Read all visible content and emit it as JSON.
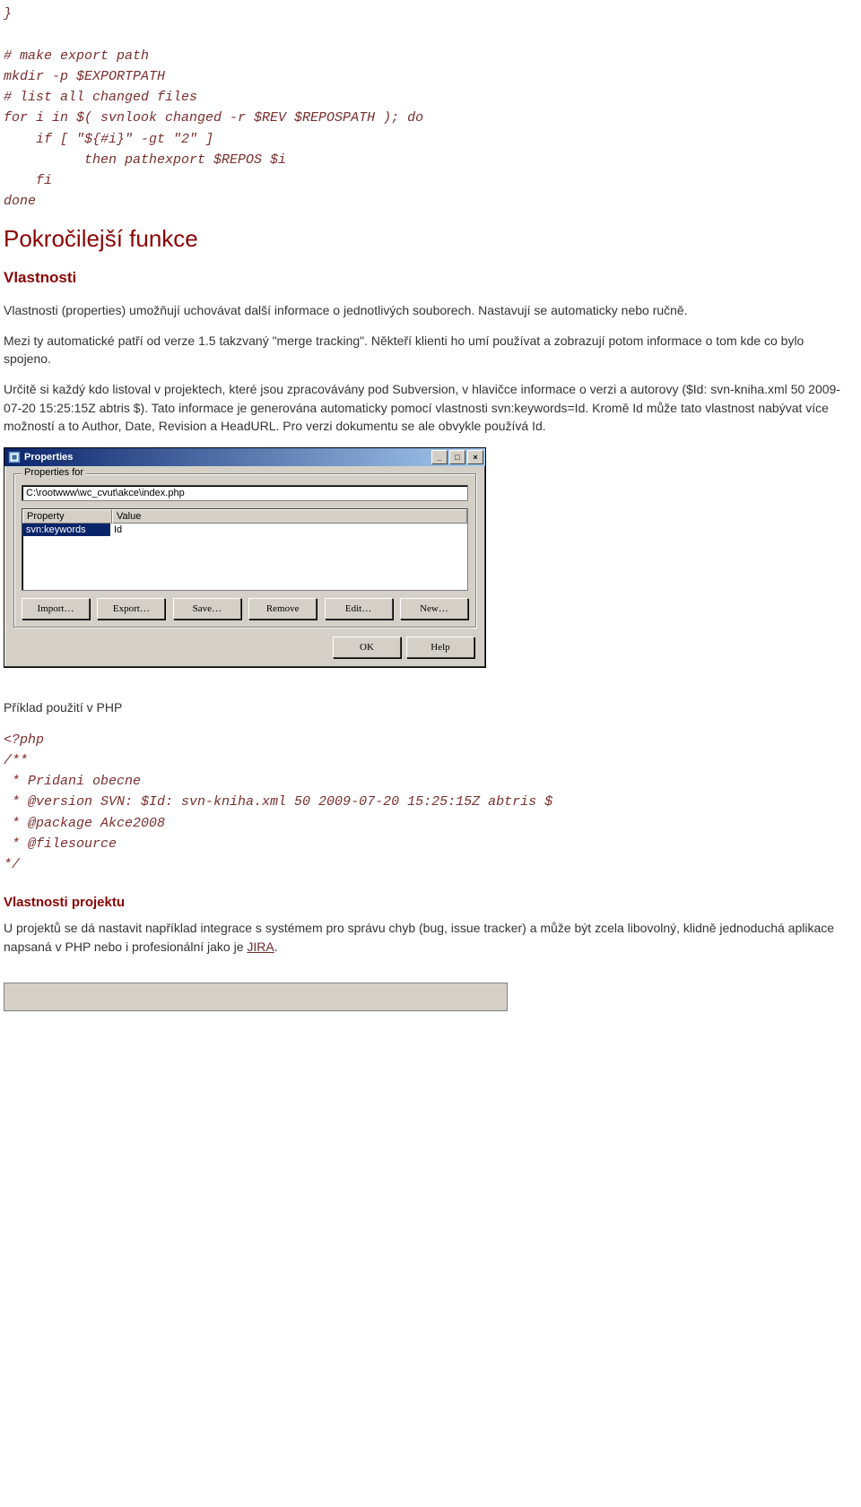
{
  "code1": "}\n\n# make export path\nmkdir -p $EXPORTPATH\n# list all changed files\nfor i in $( svnlook changed -r $REV $REPOSPATH ); do\n    if [ \"${#i}\" -gt \"2\" ]\n          then pathexport $REPOS $i\n    fi\ndone",
  "h1": "Pokročilejší funkce",
  "sec1": {
    "title": "Vlastnosti",
    "p1": "Vlastnosti (properties) umožňují uchovávat další informace o jednotlivých souborech. Nastavují se automaticky nebo ručně.",
    "p2": "Mezi ty automatické patří od verze 1.5 takzvaný \"merge tracking\". Někteří klienti ho umí používat a zobrazují potom informace o tom kde co bylo spojeno.",
    "p3": "Určitě si každý kdo listoval v projektech, které jsou zpracovávány pod Subversion, v hlavičce informace o verzi a autorovy ($Id: svn-kniha.xml 50 2009-07-20 15:25:15Z abtris $). Tato informace je generována automaticky pomocí vlastnosti svn:keywords=Id. Kromě Id může tato vlastnost nabývat více možností a to Author, Date, Revision a HeadURL. Pro verzi dokumentu se ale obvykle používá Id."
  },
  "dialog": {
    "title": "Properties",
    "group_label": "Properties for",
    "path": "C:\\rootwww\\wc_cvut\\akce\\index.php",
    "cols": [
      "Property",
      "Value"
    ],
    "row": {
      "prop": "svn:keywords",
      "val": "Id"
    },
    "buttons": {
      "import": "Import…",
      "export": "Export…",
      "save": "Save…",
      "remove": "Remove",
      "edit": "Edit…",
      "new": "New…",
      "ok": "OK",
      "help": "Help"
    }
  },
  "example_label": "Příklad použití v PHP",
  "code2": "<?php\n/**\n * Pridani obecne\n * @version SVN: $Id: svn-kniha.xml 50 2009-07-20 15:25:15Z abtris $\n * @package Akce2008\n * @filesource\n*/",
  "sec2": {
    "title": "Vlastnosti projektu",
    "p1_a": "U projektů se dá nastavit například integrace s systémem pro správu chyb (bug, issue tracker) a může být zcela libovolný, klidně jednoduchá aplikace napsaná v PHP nebo i profesionální jako je ",
    "link": "JIRA",
    "p1_b": "."
  }
}
